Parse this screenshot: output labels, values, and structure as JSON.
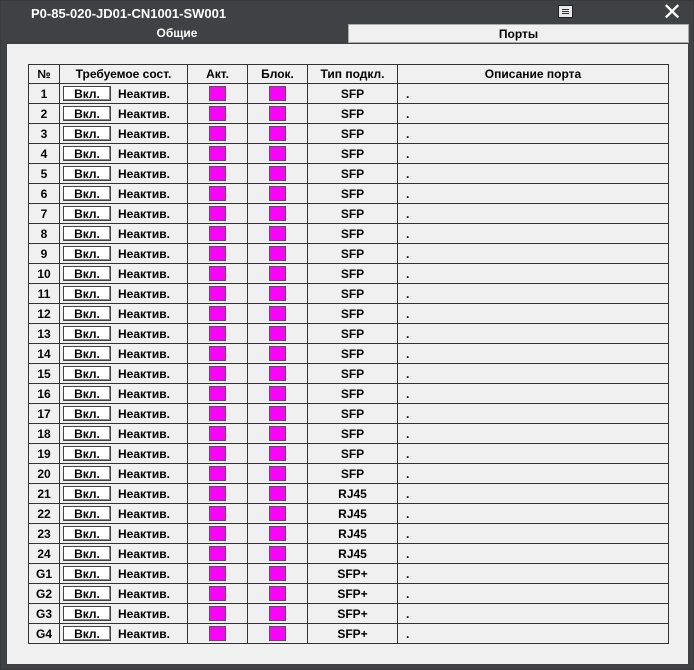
{
  "window": {
    "title": "P0-85-020-JD01-CN1001-SW001"
  },
  "tabs": [
    {
      "label": "Общие"
    },
    {
      "label": "Порты"
    }
  ],
  "table": {
    "headers": {
      "num": "№",
      "required": "Требуемое сост.",
      "act": "Акт.",
      "block": "Блок.",
      "type": "Тип подкл.",
      "desc": "Описание порта"
    },
    "indicator_color": "#ff00ff",
    "rows": [
      {
        "num": "1",
        "btn": "Вкл.",
        "state": "Неактив.",
        "type": "SFP",
        "desc": "."
      },
      {
        "num": "2",
        "btn": "Вкл.",
        "state": "Неактив.",
        "type": "SFP",
        "desc": "."
      },
      {
        "num": "3",
        "btn": "Вкл.",
        "state": "Неактив.",
        "type": "SFP",
        "desc": "."
      },
      {
        "num": "4",
        "btn": "Вкл.",
        "state": "Неактив.",
        "type": "SFP",
        "desc": "."
      },
      {
        "num": "5",
        "btn": "Вкл.",
        "state": "Неактив.",
        "type": "SFP",
        "desc": "."
      },
      {
        "num": "6",
        "btn": "Вкл.",
        "state": "Неактив.",
        "type": "SFP",
        "desc": "."
      },
      {
        "num": "7",
        "btn": "Вкл.",
        "state": "Неактив.",
        "type": "SFP",
        "desc": "."
      },
      {
        "num": "8",
        "btn": "Вкл.",
        "state": "Неактив.",
        "type": "SFP",
        "desc": "."
      },
      {
        "num": "9",
        "btn": "Вкл.",
        "state": "Неактив.",
        "type": "SFP",
        "desc": "."
      },
      {
        "num": "10",
        "btn": "Вкл.",
        "state": "Неактив.",
        "type": "SFP",
        "desc": "."
      },
      {
        "num": "11",
        "btn": "Вкл.",
        "state": "Неактив.",
        "type": "SFP",
        "desc": "."
      },
      {
        "num": "12",
        "btn": "Вкл.",
        "state": "Неактив.",
        "type": "SFP",
        "desc": "."
      },
      {
        "num": "13",
        "btn": "Вкл.",
        "state": "Неактив.",
        "type": "SFP",
        "desc": "."
      },
      {
        "num": "14",
        "btn": "Вкл.",
        "state": "Неактив.",
        "type": "SFP",
        "desc": "."
      },
      {
        "num": "15",
        "btn": "Вкл.",
        "state": "Неактив.",
        "type": "SFP",
        "desc": "."
      },
      {
        "num": "16",
        "btn": "Вкл.",
        "state": "Неактив.",
        "type": "SFP",
        "desc": "."
      },
      {
        "num": "17",
        "btn": "Вкл.",
        "state": "Неактив.",
        "type": "SFP",
        "desc": "."
      },
      {
        "num": "18",
        "btn": "Вкл.",
        "state": "Неактив.",
        "type": "SFP",
        "desc": "."
      },
      {
        "num": "19",
        "btn": "Вкл.",
        "state": "Неактив.",
        "type": "SFP",
        "desc": "."
      },
      {
        "num": "20",
        "btn": "Вкл.",
        "state": "Неактив.",
        "type": "SFP",
        "desc": "."
      },
      {
        "num": "21",
        "btn": "Вкл.",
        "state": "Неактив.",
        "type": "RJ45",
        "desc": "."
      },
      {
        "num": "22",
        "btn": "Вкл.",
        "state": "Неактив.",
        "type": "RJ45",
        "desc": "."
      },
      {
        "num": "23",
        "btn": "Вкл.",
        "state": "Неактив.",
        "type": "RJ45",
        "desc": "."
      },
      {
        "num": "24",
        "btn": "Вкл.",
        "state": "Неактив.",
        "type": "RJ45",
        "desc": "."
      },
      {
        "num": "G1",
        "btn": "Вкл.",
        "state": "Неактив.",
        "type": "SFP+",
        "desc": "."
      },
      {
        "num": "G2",
        "btn": "Вкл.",
        "state": "Неактив.",
        "type": "SFP+",
        "desc": "."
      },
      {
        "num": "G3",
        "btn": "Вкл.",
        "state": "Неактив.",
        "type": "SFP+",
        "desc": "."
      },
      {
        "num": "G4",
        "btn": "Вкл.",
        "state": "Неактив.",
        "type": "SFP+",
        "desc": "."
      }
    ]
  }
}
